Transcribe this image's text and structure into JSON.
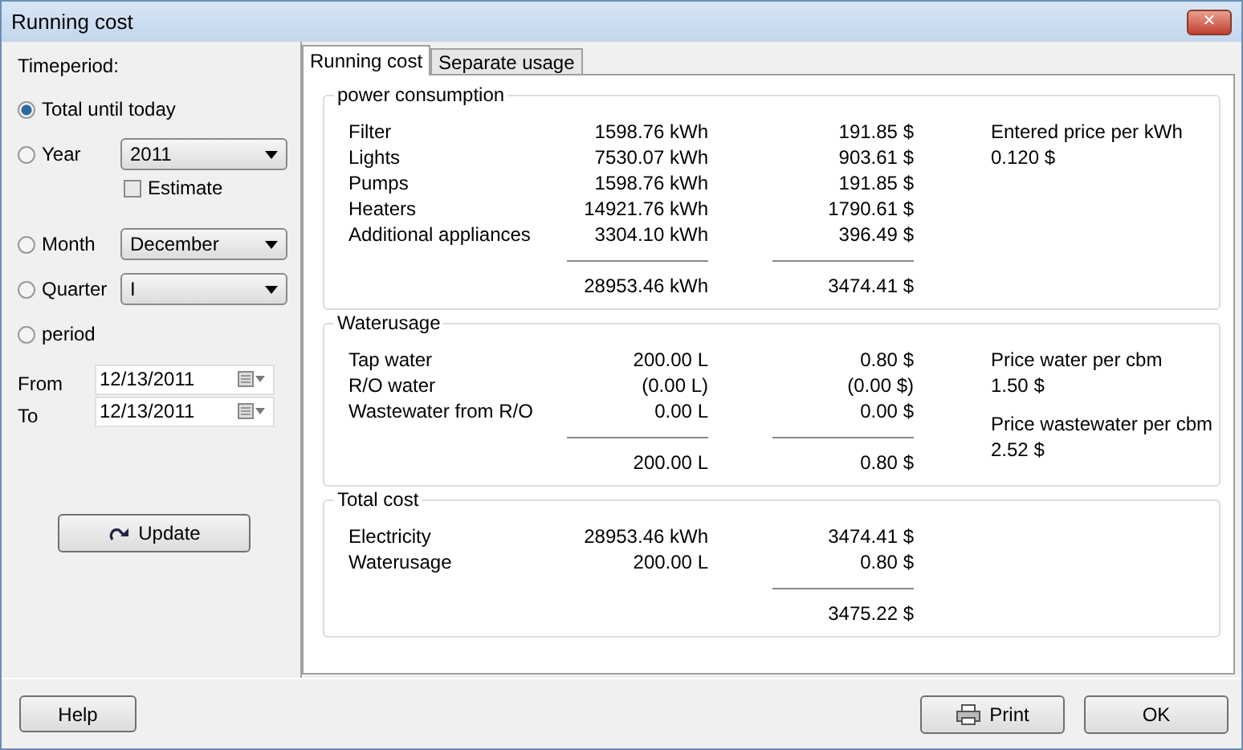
{
  "window": {
    "title": "Running cost",
    "close": "✕"
  },
  "timeperiod": {
    "label": "Timeperiod:",
    "options": [
      {
        "label": "Total until today",
        "selected": true
      },
      {
        "label": "Year",
        "selected": false,
        "dropdown": "2011",
        "checkbox": {
          "label": "Estimate",
          "checked": false
        }
      },
      {
        "label": "Month",
        "selected": false,
        "dropdown": "December"
      },
      {
        "label": "Quarter",
        "selected": false,
        "dropdown": "I"
      },
      {
        "label": "period",
        "selected": false
      }
    ],
    "dates": [
      {
        "label": "From",
        "value": "12/13/2011"
      },
      {
        "label": "To",
        "value": "12/13/2011"
      }
    ],
    "update_button": "Update"
  },
  "tabs": [
    {
      "label": "Running cost",
      "selected": true
    },
    {
      "label": "Separate usage",
      "selected": false
    }
  ],
  "groups": [
    {
      "title": "power consumption",
      "rows": [
        {
          "label": "Filter",
          "amount": "1598.76 kWh",
          "cost": "191.85 $"
        },
        {
          "label": "Lights",
          "amount": "7530.07 kWh",
          "cost": "903.61 $"
        },
        {
          "label": "Pumps",
          "amount": "1598.76 kWh",
          "cost": "191.85 $"
        },
        {
          "label": "Heaters",
          "amount": "14921.76 kWh",
          "cost": "1790.61 $"
        },
        {
          "label": "Additional appliances",
          "amount": "3304.10 kWh",
          "cost": "396.49 $"
        }
      ],
      "total": {
        "amount": "28953.46 kWh",
        "cost": "3474.41 $"
      },
      "notes": [
        {
          "label": "Entered price per kWh",
          "value": "0.120 $"
        }
      ]
    },
    {
      "title": "Waterusage",
      "rows": [
        {
          "label": "Tap water",
          "amount": "200.00 L",
          "cost": "0.80 $"
        },
        {
          "label": "R/O water",
          "amount": "(0.00 L)",
          "cost": "(0.00 $)"
        },
        {
          "label": "Wastewater from R/O",
          "amount": "0.00 L",
          "cost": "0.00 $"
        }
      ],
      "total": {
        "amount": "200.00 L",
        "cost": "0.80 $"
      },
      "notes": [
        {
          "label": "Price water per cbm",
          "value": "1.50 $"
        },
        {
          "label": "Price wastewater per cbm",
          "value": "2.52 $"
        }
      ]
    },
    {
      "title": "Total cost",
      "rows": [
        {
          "label": "Electricity",
          "amount": "28953.46 kWh",
          "cost": "3474.41 $"
        },
        {
          "label": "Waterusage",
          "amount": "200.00 L",
          "cost": "0.80 $"
        }
      ],
      "total": {
        "cost": "3475.22 $"
      }
    }
  ],
  "buttons": {
    "help": "Help",
    "print": "Print",
    "ok": "OK"
  }
}
